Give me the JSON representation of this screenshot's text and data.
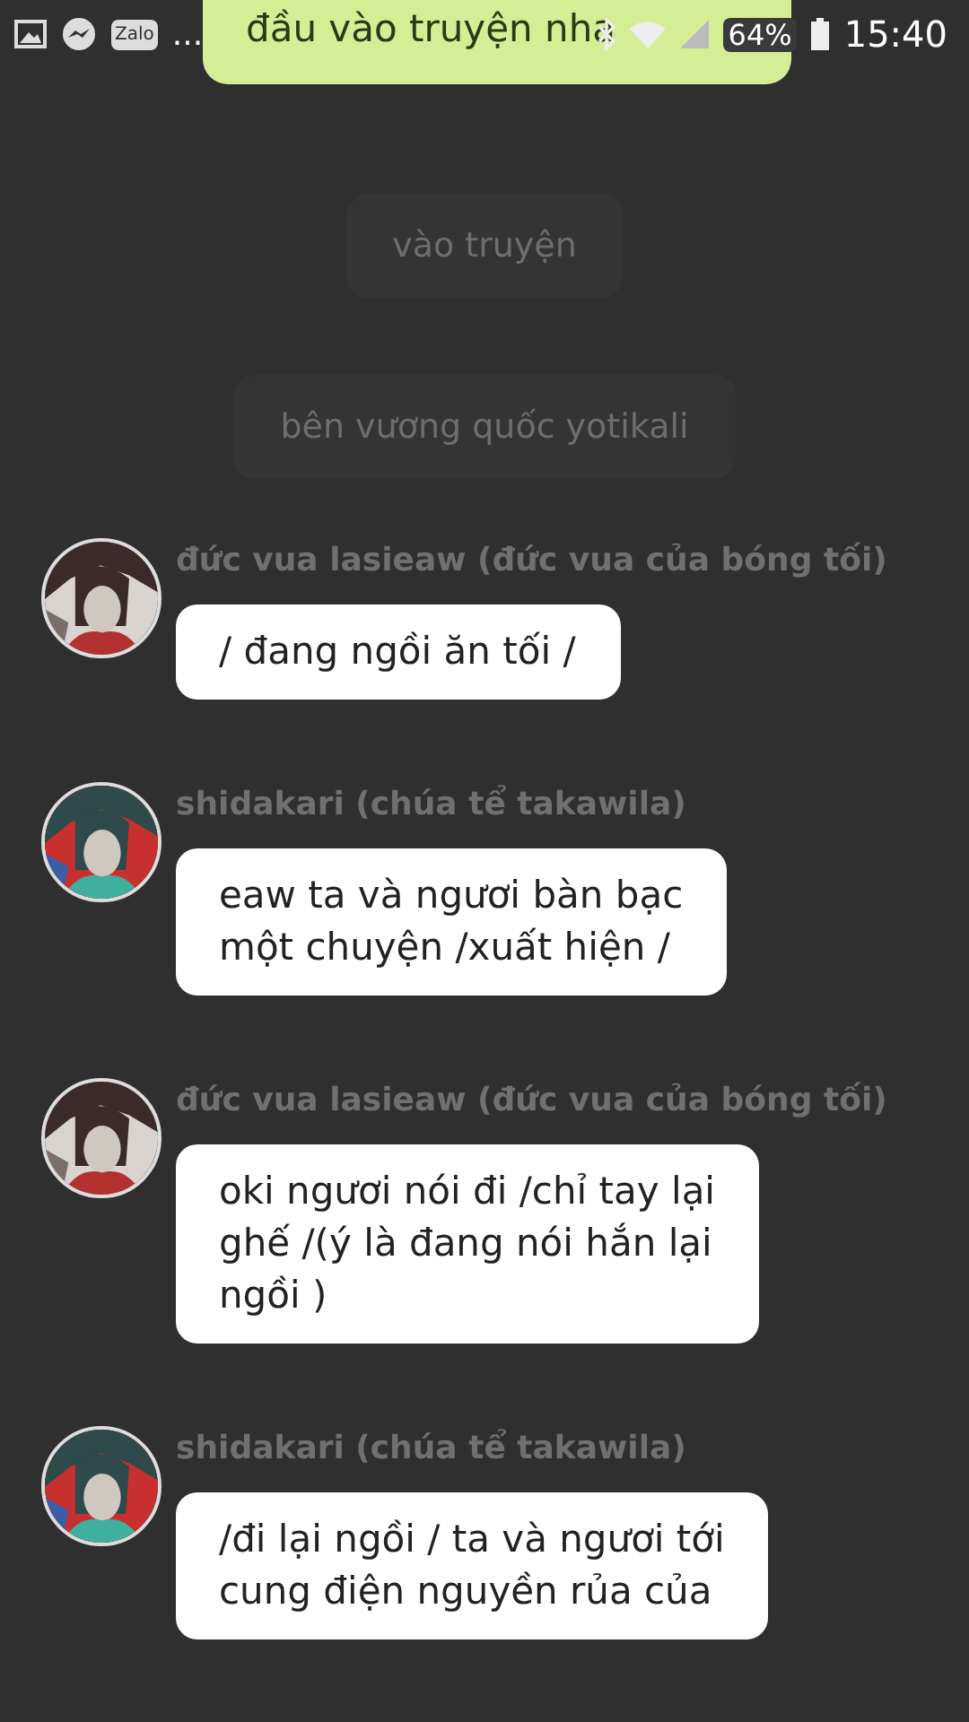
{
  "status_bar": {
    "zalo_label": "Zalo",
    "more": "...",
    "battery": "64%",
    "time": "15:40"
  },
  "top_bubble": {
    "text": "đầu vào truyện nha"
  },
  "narrations": [
    {
      "text": "vào truyện"
    },
    {
      "text": "bên vương quốc yotikali"
    }
  ],
  "messages": [
    {
      "sender": "đức vua lasieaw (đức vua của bóng tối)",
      "avatar": {
        "kind": "picture"
      },
      "lines": [
        "/ đang ngồi ăn tối /"
      ]
    },
    {
      "sender": "shidakari (chúa tể takawila)",
      "avatar": {
        "kind": "picture"
      },
      "lines": [
        "eaw ta và ngươi bàn bạc",
        "một chuyện /xuất hiện /"
      ]
    },
    {
      "sender": "đức vua lasieaw (đức vua của bóng tối)",
      "avatar": {
        "kind": "picture"
      },
      "lines": [
        "oki ngươi nói đi /chỉ tay lại",
        "ghế /(ý là đang nói hắn lại",
        "ngồi )"
      ]
    },
    {
      "sender": "shidakari (chúa tể takawila)",
      "avatar": {
        "kind": "picture"
      },
      "lines": [
        "/đi lại ngồi / ta và ngươi tới",
        "cung điện nguyền rủa của"
      ]
    }
  ]
}
